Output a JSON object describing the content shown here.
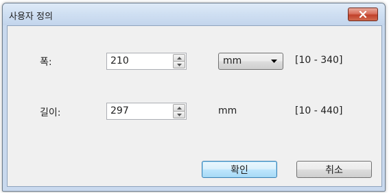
{
  "dialog": {
    "title": "사용자 정의",
    "width": {
      "label": "폭:",
      "value": "210",
      "unit_selected": "mm",
      "range": "[10 - 340]"
    },
    "length": {
      "label": "길이:",
      "value": "297",
      "unit": "mm",
      "range": "[10 - 440]"
    },
    "ok_label": "확인",
    "cancel_label": "취소"
  },
  "colors": {
    "title_bar": "#cfdff2",
    "close_button": "#c1412b",
    "client_bg": "#f0f0f0",
    "default_button_border": "#3c7fb1"
  },
  "icons": {
    "close": "close-x-icon",
    "spin_up": "triangle-up-icon",
    "spin_down": "triangle-down-icon",
    "dropdown": "triangle-down-icon"
  }
}
